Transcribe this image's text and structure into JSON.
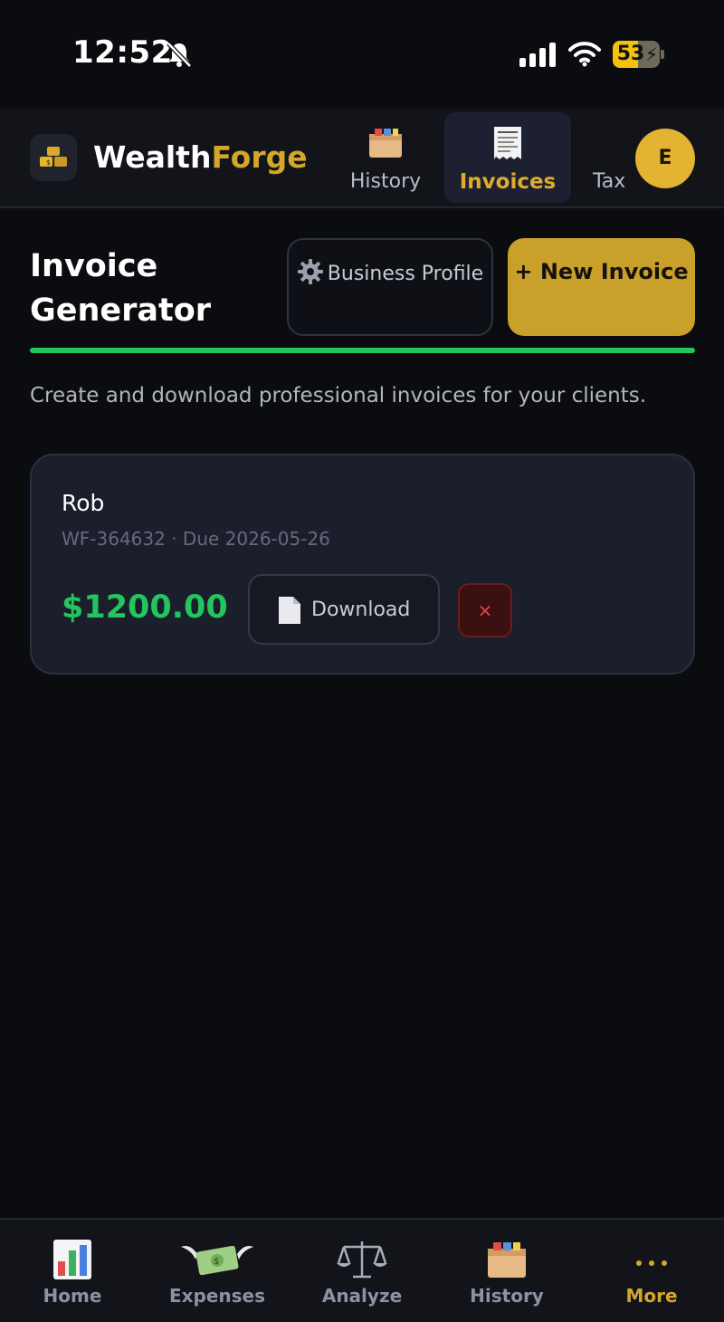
{
  "status_bar": {
    "time": "12:52",
    "battery_percent": 53,
    "battery_label": "53",
    "icons": [
      "bell-slash-icon",
      "signal-icon",
      "wifi-icon",
      "battery-charging-icon"
    ]
  },
  "header": {
    "brand_part1": "Wealth",
    "brand_part2": "Forge",
    "logo_icon": "gold-bars-icon",
    "tabs": [
      {
        "label": "History",
        "icon": "card-file-box-icon",
        "active": false
      },
      {
        "label": "Invoices",
        "icon": "receipt-icon",
        "active": true
      },
      {
        "label": "Tax",
        "icon": "",
        "active": false
      }
    ],
    "avatar_initial": "E"
  },
  "page": {
    "title": "Invoice Generator",
    "profile_button_icon": "gear-icon",
    "profile_button_label": "Business Profile",
    "new_button_label": "+ New Invoice",
    "subtitle": "Create and download professional invoices for your clients."
  },
  "invoice": {
    "client": "Rob",
    "meta": "WF-364632 · Due 2026-05-26",
    "amount": "$1200.00",
    "download_label": "Download",
    "delete_label": "×"
  },
  "bottom_nav": {
    "items": [
      {
        "label": "Home",
        "icon": "bar-chart-icon",
        "active": false
      },
      {
        "label": "Expenses",
        "icon": "money-with-wings-icon",
        "active": false
      },
      {
        "label": "Analyze",
        "icon": "balance-scale-icon",
        "active": false
      },
      {
        "label": "History",
        "icon": "card-file-box-icon",
        "active": false
      },
      {
        "label": "More",
        "icon": "more-dots-icon",
        "active": true
      }
    ]
  },
  "colors": {
    "accent_gold": "#d4a62a",
    "accent_green": "#22c55e",
    "background": "#0b0c10"
  }
}
